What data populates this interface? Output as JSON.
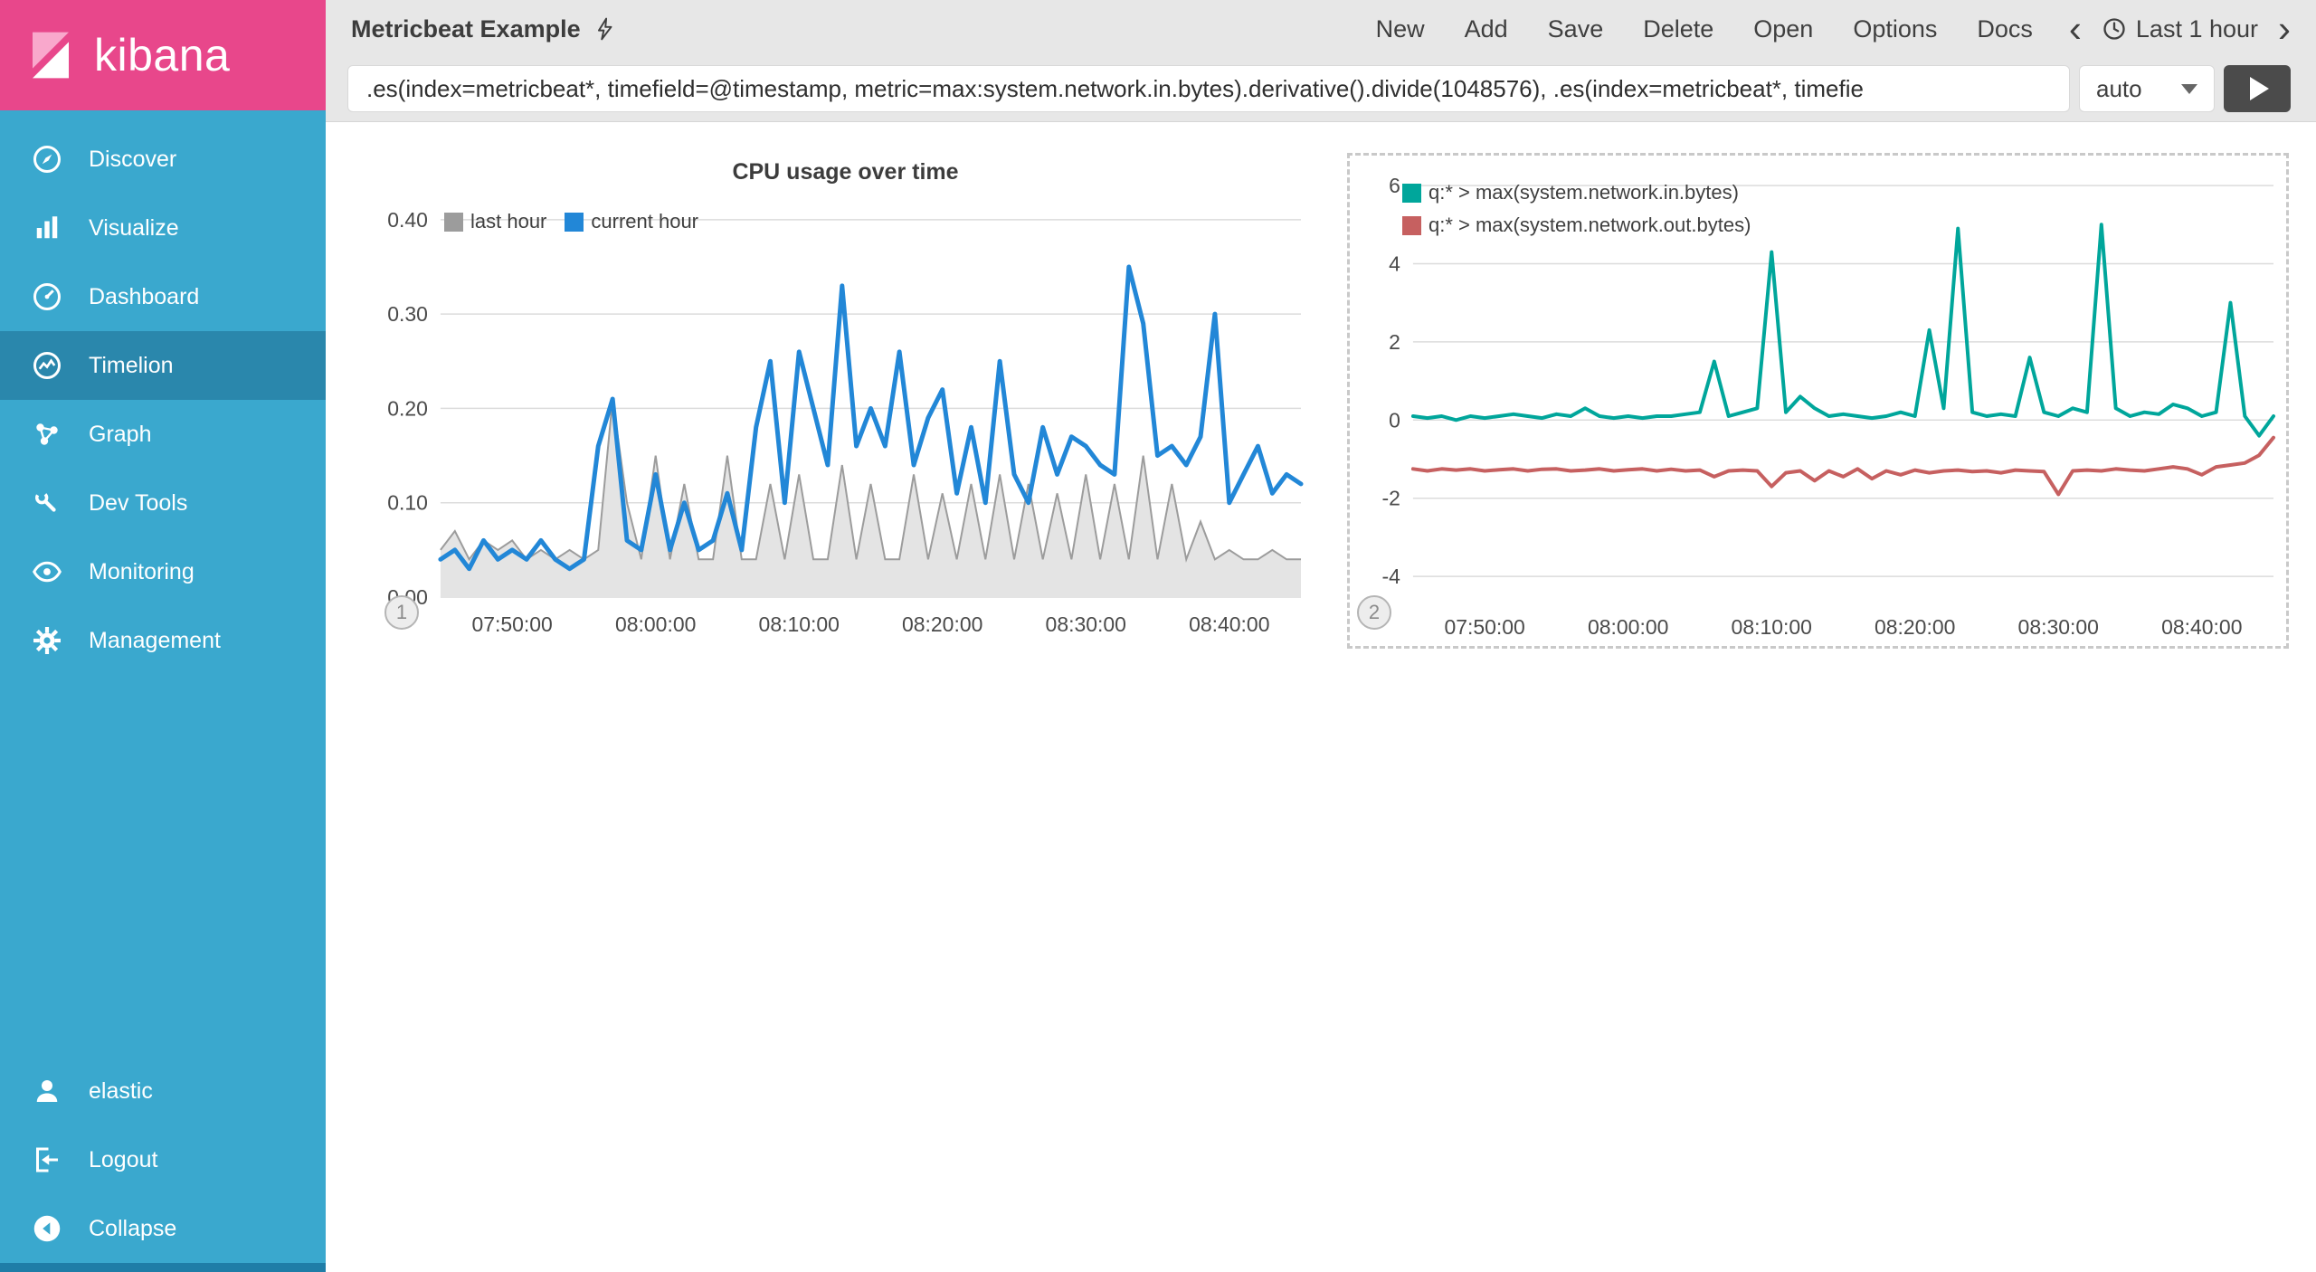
{
  "colors": {
    "sidebar_bg": "#3aa8ce",
    "sidebar_selected": "#2a87ac",
    "logo_pink": "#e8478b",
    "topbar_bg": "#e7e7e7",
    "blue_series": "#2287d7",
    "teal_series": "#00a69b",
    "red_series": "#c66060"
  },
  "sidebar": {
    "logo_text": "kibana",
    "items": [
      {
        "label": "Discover",
        "icon": "discover-icon",
        "selected": false
      },
      {
        "label": "Visualize",
        "icon": "visualize-icon",
        "selected": false
      },
      {
        "label": "Dashboard",
        "icon": "dashboard-icon",
        "selected": false
      },
      {
        "label": "Timelion",
        "icon": "timelion-icon",
        "selected": true
      },
      {
        "label": "Graph",
        "icon": "graph-icon",
        "selected": false
      },
      {
        "label": "Dev Tools",
        "icon": "wrench-icon",
        "selected": false
      },
      {
        "label": "Monitoring",
        "icon": "eye-icon",
        "selected": false
      },
      {
        "label": "Management",
        "icon": "gear-icon",
        "selected": false
      }
    ],
    "footer_items": [
      {
        "label": "elastic",
        "icon": "user-icon"
      },
      {
        "label": "Logout",
        "icon": "logout-icon"
      },
      {
        "label": "Collapse",
        "icon": "collapse-icon"
      }
    ]
  },
  "toolbar": {
    "title": "Metricbeat Example",
    "menu_items": [
      "New",
      "Add",
      "Save",
      "Delete",
      "Open",
      "Options",
      "Docs"
    ],
    "time_picker": {
      "prev": "‹",
      "label": "Last 1 hour",
      "next": "›"
    }
  },
  "query_bar": {
    "value": ".es(index=metricbeat*, timefield=@timestamp, metric=max:system.network.in.bytes).derivative().divide(1048576), .es(index=metricbeat*, timefie",
    "interval_value": "auto"
  },
  "chart_data": [
    {
      "type": "line",
      "title": "CPU usage over time",
      "panel_index": "1",
      "legend_position": "top-left",
      "grid": true,
      "x_ticks": [
        "07:50:00",
        "08:00:00",
        "08:10:00",
        "08:20:00",
        "08:30:00",
        "08:40:00"
      ],
      "x_tick_pos": [
        5,
        15,
        25,
        35,
        45,
        55
      ],
      "y_ticks": [
        0.0,
        0.1,
        0.2,
        0.3,
        0.4
      ],
      "y_decimals": 2,
      "ylim": [
        0,
        0.42
      ],
      "series": [
        {
          "name": "last hour",
          "type": "area",
          "color": "#9c9c9c",
          "fill": "#e4e4e4",
          "swatch": "#9c9c9c",
          "values": [
            0.05,
            0.07,
            0.04,
            0.06,
            0.05,
            0.06,
            0.04,
            0.05,
            0.04,
            0.05,
            0.04,
            0.05,
            0.21,
            0.1,
            0.04,
            0.15,
            0.04,
            0.12,
            0.04,
            0.04,
            0.15,
            0.04,
            0.04,
            0.12,
            0.04,
            0.13,
            0.04,
            0.04,
            0.14,
            0.04,
            0.12,
            0.04,
            0.04,
            0.13,
            0.04,
            0.11,
            0.04,
            0.12,
            0.04,
            0.13,
            0.04,
            0.12,
            0.04,
            0.11,
            0.04,
            0.13,
            0.04,
            0.12,
            0.04,
            0.15,
            0.04,
            0.12,
            0.04,
            0.08,
            0.04,
            0.05,
            0.04,
            0.04,
            0.05,
            0.04,
            0.04
          ]
        },
        {
          "name": "current hour",
          "type": "line",
          "color": "#2287d7",
          "width": 5,
          "values": [
            0.04,
            0.05,
            0.03,
            0.06,
            0.04,
            0.05,
            0.04,
            0.06,
            0.04,
            0.03,
            0.04,
            0.16,
            0.21,
            0.06,
            0.05,
            0.13,
            0.05,
            0.1,
            0.05,
            0.06,
            0.11,
            0.05,
            0.18,
            0.25,
            0.1,
            0.26,
            0.2,
            0.14,
            0.33,
            0.16,
            0.2,
            0.16,
            0.26,
            0.14,
            0.19,
            0.22,
            0.11,
            0.18,
            0.1,
            0.25,
            0.13,
            0.1,
            0.18,
            0.13,
            0.17,
            0.16,
            0.14,
            0.13,
            0.35,
            0.29,
            0.15,
            0.16,
            0.14,
            0.17,
            0.3,
            0.1,
            0.13,
            0.16,
            0.11,
            0.13,
            0.12
          ]
        }
      ]
    },
    {
      "type": "line",
      "title": "",
      "panel_index": "2",
      "selected": true,
      "legend_position": "top-left",
      "grid": true,
      "x_ticks": [
        "07:50:00",
        "08:00:00",
        "08:10:00",
        "08:20:00",
        "08:30:00",
        "08:40:00"
      ],
      "x_tick_pos": [
        5,
        15,
        25,
        35,
        45,
        55
      ],
      "y_ticks": [
        -4,
        -2,
        0,
        2,
        4,
        6
      ],
      "y_decimals": 0,
      "ylim": [
        -4.6,
        6.35
      ],
      "series": [
        {
          "name": "q:* > max(system.network.in.bytes)",
          "type": "line",
          "color": "#00a69b",
          "width": 4,
          "values": [
            0.1,
            0.05,
            0.1,
            0.0,
            0.1,
            0.05,
            0.1,
            0.15,
            0.1,
            0.05,
            0.15,
            0.1,
            0.3,
            0.1,
            0.05,
            0.1,
            0.05,
            0.1,
            0.1,
            0.15,
            0.2,
            1.5,
            0.1,
            0.2,
            0.3,
            4.3,
            0.2,
            0.6,
            0.3,
            0.1,
            0.15,
            0.1,
            0.05,
            0.1,
            0.2,
            0.1,
            2.3,
            0.3,
            4.9,
            0.2,
            0.1,
            0.15,
            0.1,
            1.6,
            0.2,
            0.1,
            0.3,
            0.2,
            5.0,
            0.3,
            0.1,
            0.2,
            0.15,
            0.4,
            0.3,
            0.1,
            0.2,
            3.0,
            0.1,
            -0.4,
            0.1
          ]
        },
        {
          "name": "q:* > max(system.network.out.bytes)",
          "type": "line",
          "color": "#c66060",
          "width": 4,
          "values": [
            -1.25,
            -1.3,
            -1.25,
            -1.28,
            -1.25,
            -1.3,
            -1.27,
            -1.25,
            -1.3,
            -1.26,
            -1.25,
            -1.3,
            -1.28,
            -1.25,
            -1.3,
            -1.27,
            -1.25,
            -1.3,
            -1.26,
            -1.3,
            -1.28,
            -1.45,
            -1.3,
            -1.28,
            -1.3,
            -1.7,
            -1.35,
            -1.3,
            -1.55,
            -1.3,
            -1.45,
            -1.25,
            -1.5,
            -1.3,
            -1.4,
            -1.28,
            -1.35,
            -1.3,
            -1.28,
            -1.32,
            -1.3,
            -1.35,
            -1.28,
            -1.3,
            -1.32,
            -1.9,
            -1.3,
            -1.28,
            -1.3,
            -1.25,
            -1.28,
            -1.3,
            -1.25,
            -1.2,
            -1.25,
            -1.4,
            -1.2,
            -1.15,
            -1.1,
            -0.9,
            -0.45
          ]
        }
      ]
    }
  ]
}
